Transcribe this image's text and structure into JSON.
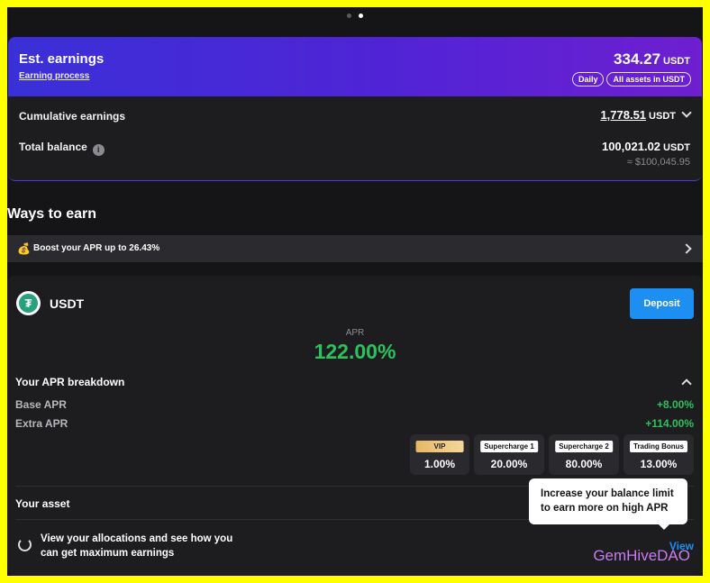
{
  "earnings": {
    "title": "Est. earnings",
    "link": "Earning process",
    "amount": "334.27",
    "currency": "USDT",
    "pills": [
      "Daily",
      "All assets in USDT"
    ]
  },
  "summary": {
    "cumulative_label": "Cumulative earnings",
    "cumulative_value": "1,778.51",
    "cumulative_currency": "USDT",
    "balance_label": "Total balance",
    "balance_value": "100,021.02",
    "balance_currency": "USDT",
    "balance_usd": "≈ $100,045.95"
  },
  "ways": {
    "title": "Ways to earn",
    "boost_icon": "money-bag-icon",
    "boost_text": "Boost your APR up to 26.43%"
  },
  "asset": {
    "icon": "tether-icon",
    "name": "USDT",
    "deposit_label": "Deposit",
    "apr_label": "APR",
    "apr_value": "122.00%",
    "breakdown_title": "Your APR breakdown",
    "base_label": "Base APR",
    "base_value": "+8.00%",
    "extra_label": "Extra APR",
    "extra_value": "+114.00%",
    "tiers": [
      {
        "tag": "VIP",
        "value": "1.00%"
      },
      {
        "tag": "Supercharge 1",
        "value": "20.00%"
      },
      {
        "tag": "Supercharge 2",
        "value": "80.00%"
      },
      {
        "tag": "Trading Bonus",
        "value": "13.00%"
      }
    ],
    "your_asset_label": "Your asset",
    "alloc_text": "View your allocations and see how you can get maximum earnings",
    "view_label": "View"
  },
  "tooltip": {
    "text": "Increase your balance limit to earn more on high APR"
  },
  "watermark": "GemHiveDAO",
  "colors": {
    "accent_blue": "#1d8ef2",
    "positive_green": "#2ec05d",
    "gradient_start": "#3a30d8",
    "gradient_end": "#6e1fd0",
    "border_yellow": "#ffff00"
  }
}
